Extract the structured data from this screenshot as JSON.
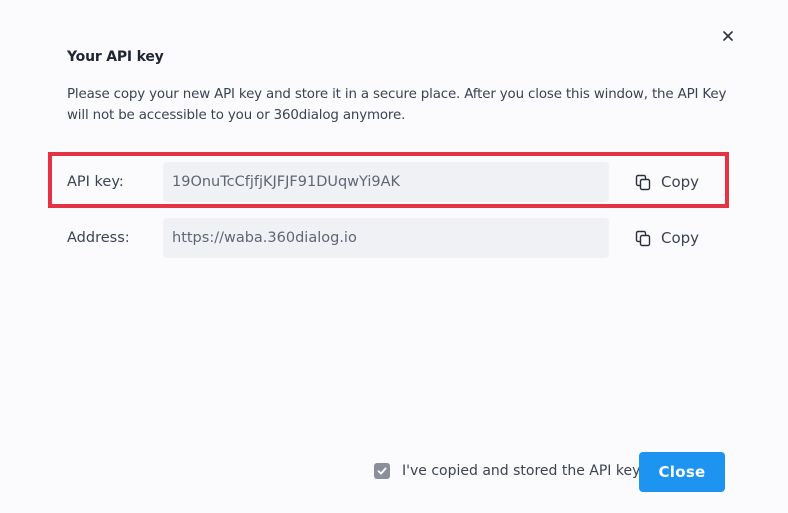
{
  "dialog": {
    "title": "Your API key",
    "description": "Please copy your new API key and store it in a secure place. After you close this window, the API Key will not be accessible to you or 360dialog anymore.",
    "close_icon": "close-icon"
  },
  "fields": [
    {
      "label": "API key:",
      "value": "19OnuTcCfjfjKJFJF91DUqwYi9AK",
      "copy_label": "Copy",
      "highlighted": true
    },
    {
      "label": "Address:",
      "value": "https://waba.360dialog.io",
      "copy_label": "Copy",
      "highlighted": false
    }
  ],
  "footer": {
    "checkbox_checked": true,
    "checkbox_label": "I've copied and stored the API key",
    "close_button_label": "Close"
  },
  "colors": {
    "accent": "#1c94f0",
    "highlight": "#e53343",
    "field_bg": "#eff1f5"
  }
}
